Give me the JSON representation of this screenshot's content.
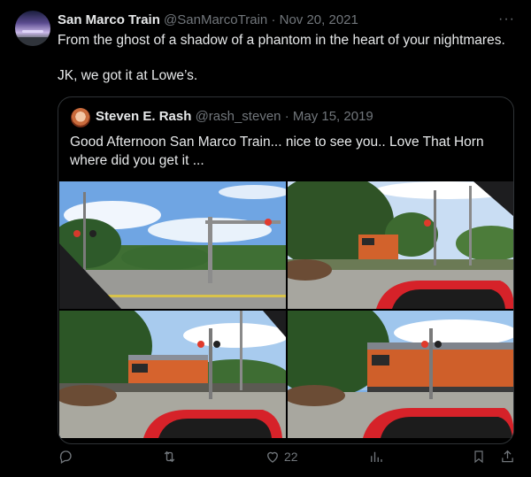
{
  "tweet": {
    "author_name": "San Marco Train",
    "author_handle": "@SanMarcoTrain",
    "separator": "·",
    "date": "Nov 20, 2021",
    "text_line1": "From the ghost of a shadow of a phantom in the heart of your nightmares.",
    "text_line2": "JK, we got it at Lowe’s."
  },
  "quoted": {
    "author_name": "Steven E. Rash",
    "author_handle": "@rash_steven",
    "separator": "·",
    "date": "May 15, 2019",
    "text": "Good Afternoon San Marco Train... nice to see you.. Love That Horn where did you get it ..."
  },
  "actions": {
    "reply_icon": "reply-icon",
    "retweet_icon": "retweet-icon",
    "like_icon": "like-icon",
    "like_count": "22",
    "views_icon": "views-icon",
    "bookmark_icon": "bookmark-icon",
    "share_icon": "share-icon"
  },
  "colors": {
    "background": "#000000",
    "text": "#e7e9ea",
    "muted": "#71767b",
    "border": "#2f3336"
  }
}
